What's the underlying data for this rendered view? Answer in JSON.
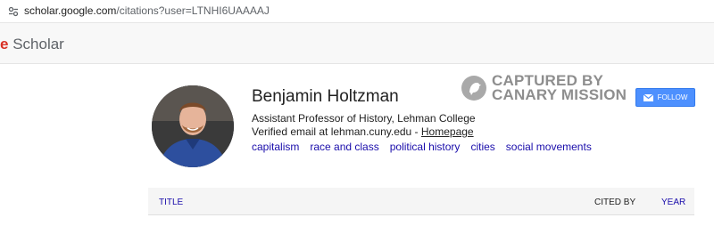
{
  "browser": {
    "url_host": "scholar.google.com",
    "url_path": "/citations?user=LTNHI6UAAAAJ",
    "site_icon": "tune-icon"
  },
  "header": {
    "logo_first": "e",
    "logo_rest": " Scholar"
  },
  "profile": {
    "name": "Benjamin Holtzman",
    "affiliation": "Assistant Professor of History, Lehman College",
    "email_prefix": "Verified email at lehman.cuny.edu - ",
    "homepage_label": "Homepage",
    "interests": [
      "capitalism",
      "race and class",
      "political history",
      "cities",
      "social movements"
    ]
  },
  "watermark": {
    "line1": "CAPTURED BY",
    "line2": "CANARY MISSION"
  },
  "follow": {
    "label": "FOLLOW",
    "icon": "mail-icon"
  },
  "table": {
    "title_col": "TITLE",
    "cited_col": "CITED BY",
    "year_col": "YEAR"
  },
  "colors": {
    "link": "#1a0dab",
    "follow_bg": "#4d90fe",
    "logo_red": "#d93025"
  }
}
